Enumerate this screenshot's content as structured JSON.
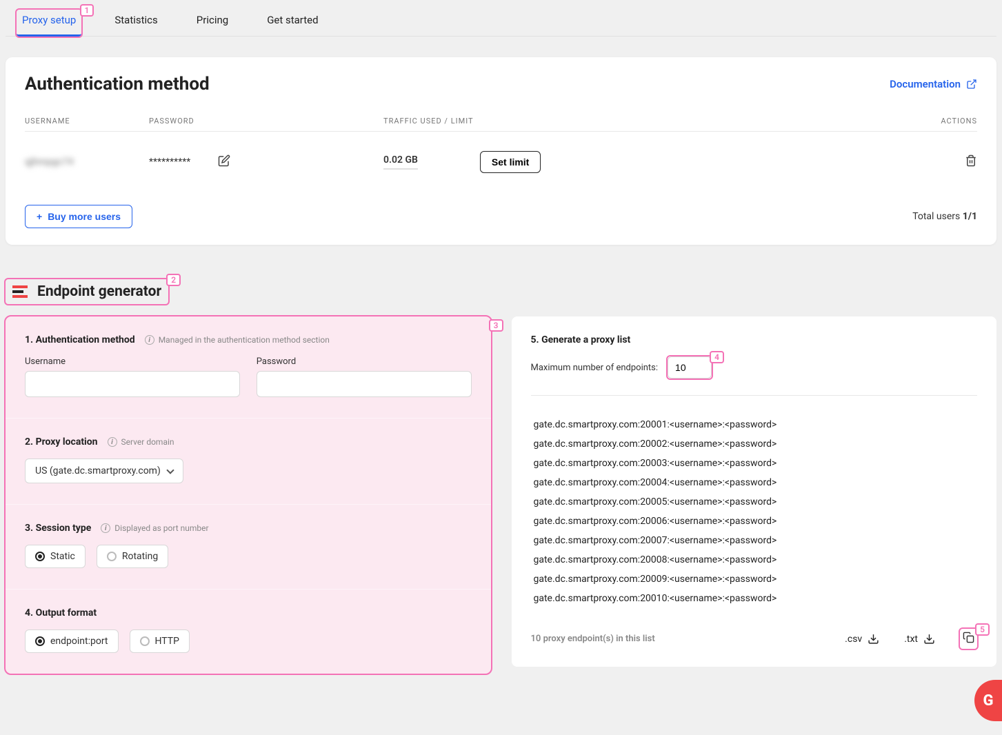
{
  "tabs": {
    "proxy_setup": "Proxy setup",
    "statistics": "Statistics",
    "pricing": "Pricing",
    "get_started": "Get started"
  },
  "auth_card": {
    "title": "Authentication method",
    "doc_link": "Documentation",
    "columns": {
      "username": "USERNAME",
      "password": "PASSWORD",
      "traffic": "TRAFFIC USED / LIMIT",
      "actions": "ACTIONS"
    },
    "row": {
      "username": "qjhmpgc74",
      "password": "**********",
      "traffic": "0.02 GB",
      "set_limit": "Set limit"
    },
    "buy_more": "Buy more users",
    "total_users_label": "Total users ",
    "total_users_value": "1/1"
  },
  "endpoint_gen": {
    "title": "Endpoint generator",
    "step1": {
      "label": "1. Authentication method",
      "hint": "Managed in the authentication method section",
      "username_label": "Username",
      "password_label": "Password"
    },
    "step2": {
      "label": "2. Proxy location",
      "hint": "Server domain",
      "selected": "US (gate.dc.smartproxy.com)"
    },
    "step3": {
      "label": "3. Session type",
      "hint": "Displayed as port number",
      "static": "Static",
      "rotating": "Rotating"
    },
    "step4": {
      "label": "4. Output format",
      "endpoint_port": "endpoint:port",
      "http": "HTTP"
    },
    "step5": {
      "label": "5. Generate a proxy list",
      "max_label": "Maximum number of endpoints:",
      "max_value": "10"
    },
    "list": [
      "gate.dc.smartproxy.com:20001:<username>:<password>",
      "gate.dc.smartproxy.com:20002:<username>:<password>",
      "gate.dc.smartproxy.com:20003:<username>:<password>",
      "gate.dc.smartproxy.com:20004:<username>:<password>",
      "gate.dc.smartproxy.com:20005:<username>:<password>",
      "gate.dc.smartproxy.com:20006:<username>:<password>",
      "gate.dc.smartproxy.com:20007:<username>:<password>",
      "gate.dc.smartproxy.com:20008:<username>:<password>",
      "gate.dc.smartproxy.com:20009:<username>:<password>",
      "gate.dc.smartproxy.com:20010:<username>:<password>"
    ],
    "list_count": "10 proxy endpoint(s) in this list",
    "export_csv": ".csv",
    "export_txt": ".txt"
  },
  "annotations": {
    "1": "1",
    "2": "2",
    "3": "3",
    "4": "4",
    "5": "5"
  },
  "g_badge": "G"
}
